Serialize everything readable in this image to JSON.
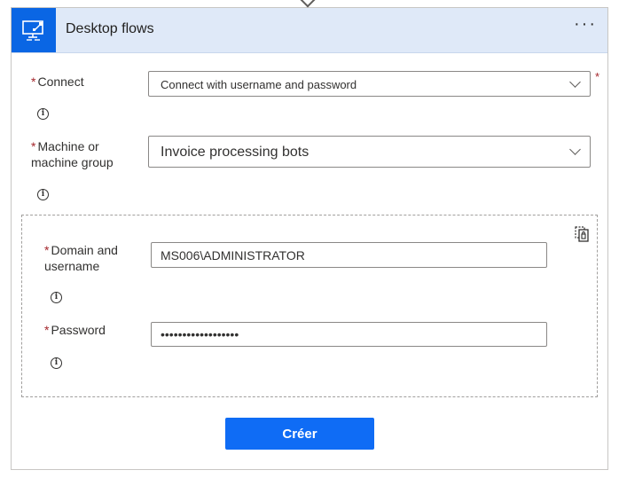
{
  "header": {
    "title": "Desktop flows",
    "app_icon": "desktop-flow-icon",
    "more_label": "···",
    "accent_color": "#0a66e4",
    "bg_color": "#dfe9f8"
  },
  "form": {
    "required_mark": "*",
    "connect": {
      "label": "Connect",
      "value": "Connect with username and password"
    },
    "machine": {
      "label_line1": "Machine or",
      "label_line2": "machine group",
      "value": "Invoice processing bots"
    },
    "domain": {
      "label_line1": "Domain and",
      "label_line2": "username",
      "value": "MS006\\ADMINISTRATOR"
    },
    "password": {
      "label": "Password",
      "value": "••••••••••••••••••"
    },
    "info_glyph": "i"
  },
  "actions": {
    "create_label": "Créer",
    "button_color": "#0f6cf5"
  }
}
